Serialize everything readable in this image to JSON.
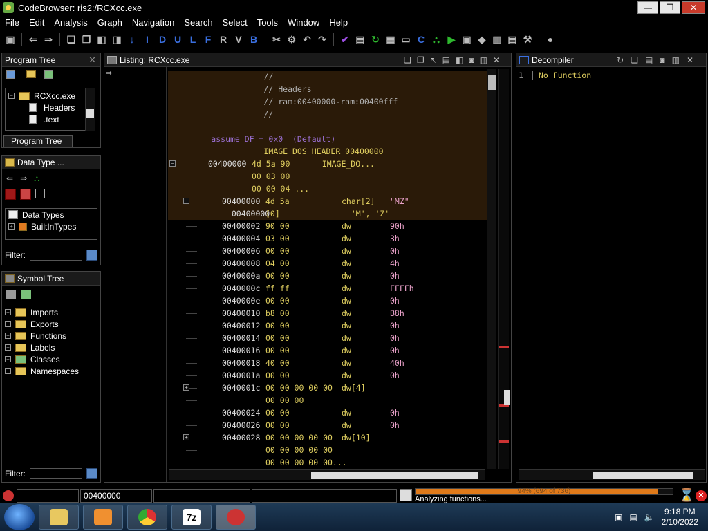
{
  "window": {
    "title": "CodeBrowser: ris2:/RCXcc.exe",
    "minimize": "—",
    "maximize": "❐",
    "close": "✕"
  },
  "menu": [
    "File",
    "Edit",
    "Analysis",
    "Graph",
    "Navigation",
    "Search",
    "Select",
    "Tools",
    "Window",
    "Help"
  ],
  "toolbar": {
    "letters": [
      "I",
      "D",
      "U",
      "L",
      "F",
      "R",
      "V",
      "B"
    ]
  },
  "program_tree": {
    "title": "Program Tree",
    "tab": "Program Tree",
    "items": [
      {
        "label": "RCXcc.exe",
        "level": 0
      },
      {
        "label": "Headers",
        "level": 1
      },
      {
        "label": ".text",
        "level": 1
      }
    ]
  },
  "data_type_manager": {
    "title": "Data Type ...",
    "items": [
      {
        "label": "Data Types"
      },
      {
        "label": "BuiltInTypes"
      }
    ],
    "filter_label": "Filter:"
  },
  "symbol_tree": {
    "title": "Symbol Tree",
    "items": [
      "Imports",
      "Exports",
      "Functions",
      "Labels",
      "Classes",
      "Namespaces"
    ],
    "filter_label": "Filter:"
  },
  "listing": {
    "title": "Listing:  RCXcc.exe",
    "rows": [
      {
        "text": "                    //",
        "kind": "comment",
        "hl": true
      },
      {
        "text": "                    // Headers",
        "kind": "comment",
        "hl": true
      },
      {
        "text": "                    // ram:00400000-ram:00400fff",
        "kind": "comment",
        "hl": true
      },
      {
        "text": "                    //",
        "kind": "comment",
        "hl": true
      },
      {
        "text": "",
        "kind": "blank",
        "hl": true
      },
      {
        "text": "         assume DF = 0x0  (Default)",
        "kind": "assume",
        "hl": true
      },
      {
        "text": "                    IMAGE_DOS_HEADER_00400000",
        "kind": "label",
        "hl": true
      },
      {
        "addr": "00400000",
        "bytes": "4d 5a 90",
        "mnem": "   IMAGE_DO...",
        "val": "",
        "indent": 58,
        "hl": true
      },
      {
        "addr": "",
        "bytes": "00 03 00",
        "mnem": "",
        "val": "",
        "indent": 58,
        "hl": true
      },
      {
        "addr": "",
        "bytes": "00 00 04 ...",
        "mnem": "",
        "val": "",
        "indent": 58,
        "hl": true
      },
      {
        "addr": "00400000",
        "bytes": "4d 5a",
        "mnem": "char[2]",
        "val": "\"MZ\"",
        "indent": 78,
        "hl": true
      },
      {
        "addr": "  00400000",
        "bytes": "[0]",
        "mnem": "  'M', 'Z'",
        "val": "",
        "indent": 78,
        "hl": true
      },
      {
        "addr": "00400002",
        "bytes": "90 00",
        "mnem": "dw",
        "val": "90h",
        "indent": 78
      },
      {
        "addr": "00400004",
        "bytes": "03 00",
        "mnem": "dw",
        "val": "3h",
        "indent": 78
      },
      {
        "addr": "00400006",
        "bytes": "00 00",
        "mnem": "dw",
        "val": "0h",
        "indent": 78
      },
      {
        "addr": "00400008",
        "bytes": "04 00",
        "mnem": "dw",
        "val": "4h",
        "indent": 78
      },
      {
        "addr": "0040000a",
        "bytes": "00 00",
        "mnem": "dw",
        "val": "0h",
        "indent": 78
      },
      {
        "addr": "0040000c",
        "bytes": "ff ff",
        "mnem": "dw",
        "val": "FFFFh",
        "indent": 78
      },
      {
        "addr": "0040000e",
        "bytes": "00 00",
        "mnem": "dw",
        "val": "0h",
        "indent": 78
      },
      {
        "addr": "00400010",
        "bytes": "b8 00",
        "mnem": "dw",
        "val": "B8h",
        "indent": 78
      },
      {
        "addr": "00400012",
        "bytes": "00 00",
        "mnem": "dw",
        "val": "0h",
        "indent": 78
      },
      {
        "addr": "00400014",
        "bytes": "00 00",
        "mnem": "dw",
        "val": "0h",
        "indent": 78
      },
      {
        "addr": "00400016",
        "bytes": "00 00",
        "mnem": "dw",
        "val": "0h",
        "indent": 78
      },
      {
        "addr": "00400018",
        "bytes": "40 00",
        "mnem": "dw",
        "val": "40h",
        "indent": 78
      },
      {
        "addr": "0040001a",
        "bytes": "00 00",
        "mnem": "dw",
        "val": "0h",
        "indent": 78
      },
      {
        "addr": "0040001c",
        "bytes": "00 00 00 00 00",
        "mnem": "dw[4]",
        "val": "",
        "indent": 78
      },
      {
        "addr": "",
        "bytes": "00 00 00",
        "mnem": "",
        "val": "",
        "indent": 78
      },
      {
        "addr": "00400024",
        "bytes": "00 00",
        "mnem": "dw",
        "val": "0h",
        "indent": 78
      },
      {
        "addr": "00400026",
        "bytes": "00 00",
        "mnem": "dw",
        "val": "0h",
        "indent": 78
      },
      {
        "addr": "00400028",
        "bytes": "00 00 00 00 00",
        "mnem": "dw[10]",
        "val": "",
        "indent": 78
      },
      {
        "addr": "",
        "bytes": "00 00 00 00 00",
        "mnem": "",
        "val": "",
        "indent": 78
      },
      {
        "addr": "",
        "bytes": "00 00 00 00 00...",
        "mnem": "",
        "val": "",
        "indent": 78
      }
    ]
  },
  "decompiler": {
    "title": "Decompiler",
    "line_number": "1",
    "text": "No Function"
  },
  "status": {
    "address": "00400000",
    "progress_text": "94% (694 of 736)",
    "progress": 0.94,
    "message": "Analyzing functions..."
  },
  "taskbar": {
    "apps": [
      "explorer",
      "media-player",
      "chrome",
      "7-zip",
      "ghidra"
    ],
    "time": "9:18 PM",
    "date": "2/10/2022"
  }
}
